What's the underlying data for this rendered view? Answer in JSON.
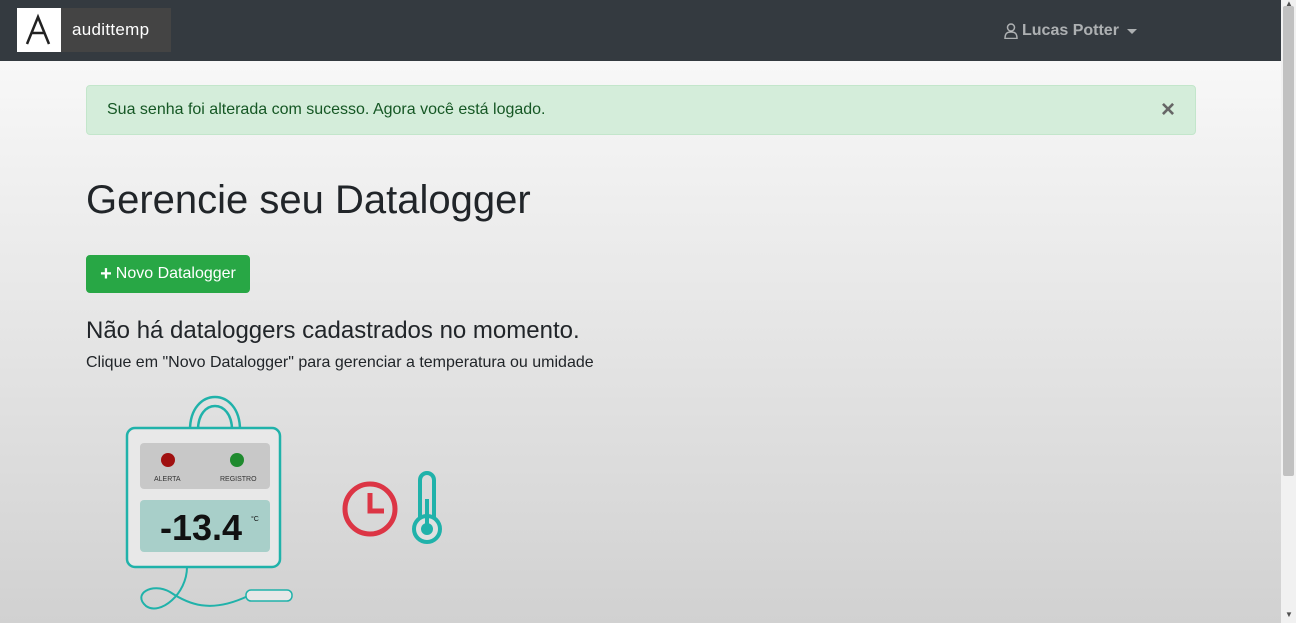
{
  "brand": {
    "name": "audittemp",
    "logo_letter": "A"
  },
  "user_menu": {
    "name": "Lucas Potter",
    "icon": "user-icon"
  },
  "alert": {
    "message": "Sua senha foi alterada com sucesso. Agora você está logado.",
    "close": "×",
    "color": "#d4edda"
  },
  "page": {
    "title": "Gerencie seu Datalogger",
    "new_button": {
      "icon": "+",
      "label": "Novo Datalogger",
      "color": "#28a745"
    },
    "empty_title": "Não há dataloggers cadastrados no momento.",
    "empty_subtitle": "Clique em \"Novo Datalogger\" para gerenciar a temperatura ou umidade"
  },
  "illustration": {
    "alert_label": "ALERTA",
    "record_label": "REGISTRO",
    "reading": "-13.4",
    "unit": "°C",
    "icons": [
      "clock-icon",
      "thermometer-icon"
    ]
  }
}
